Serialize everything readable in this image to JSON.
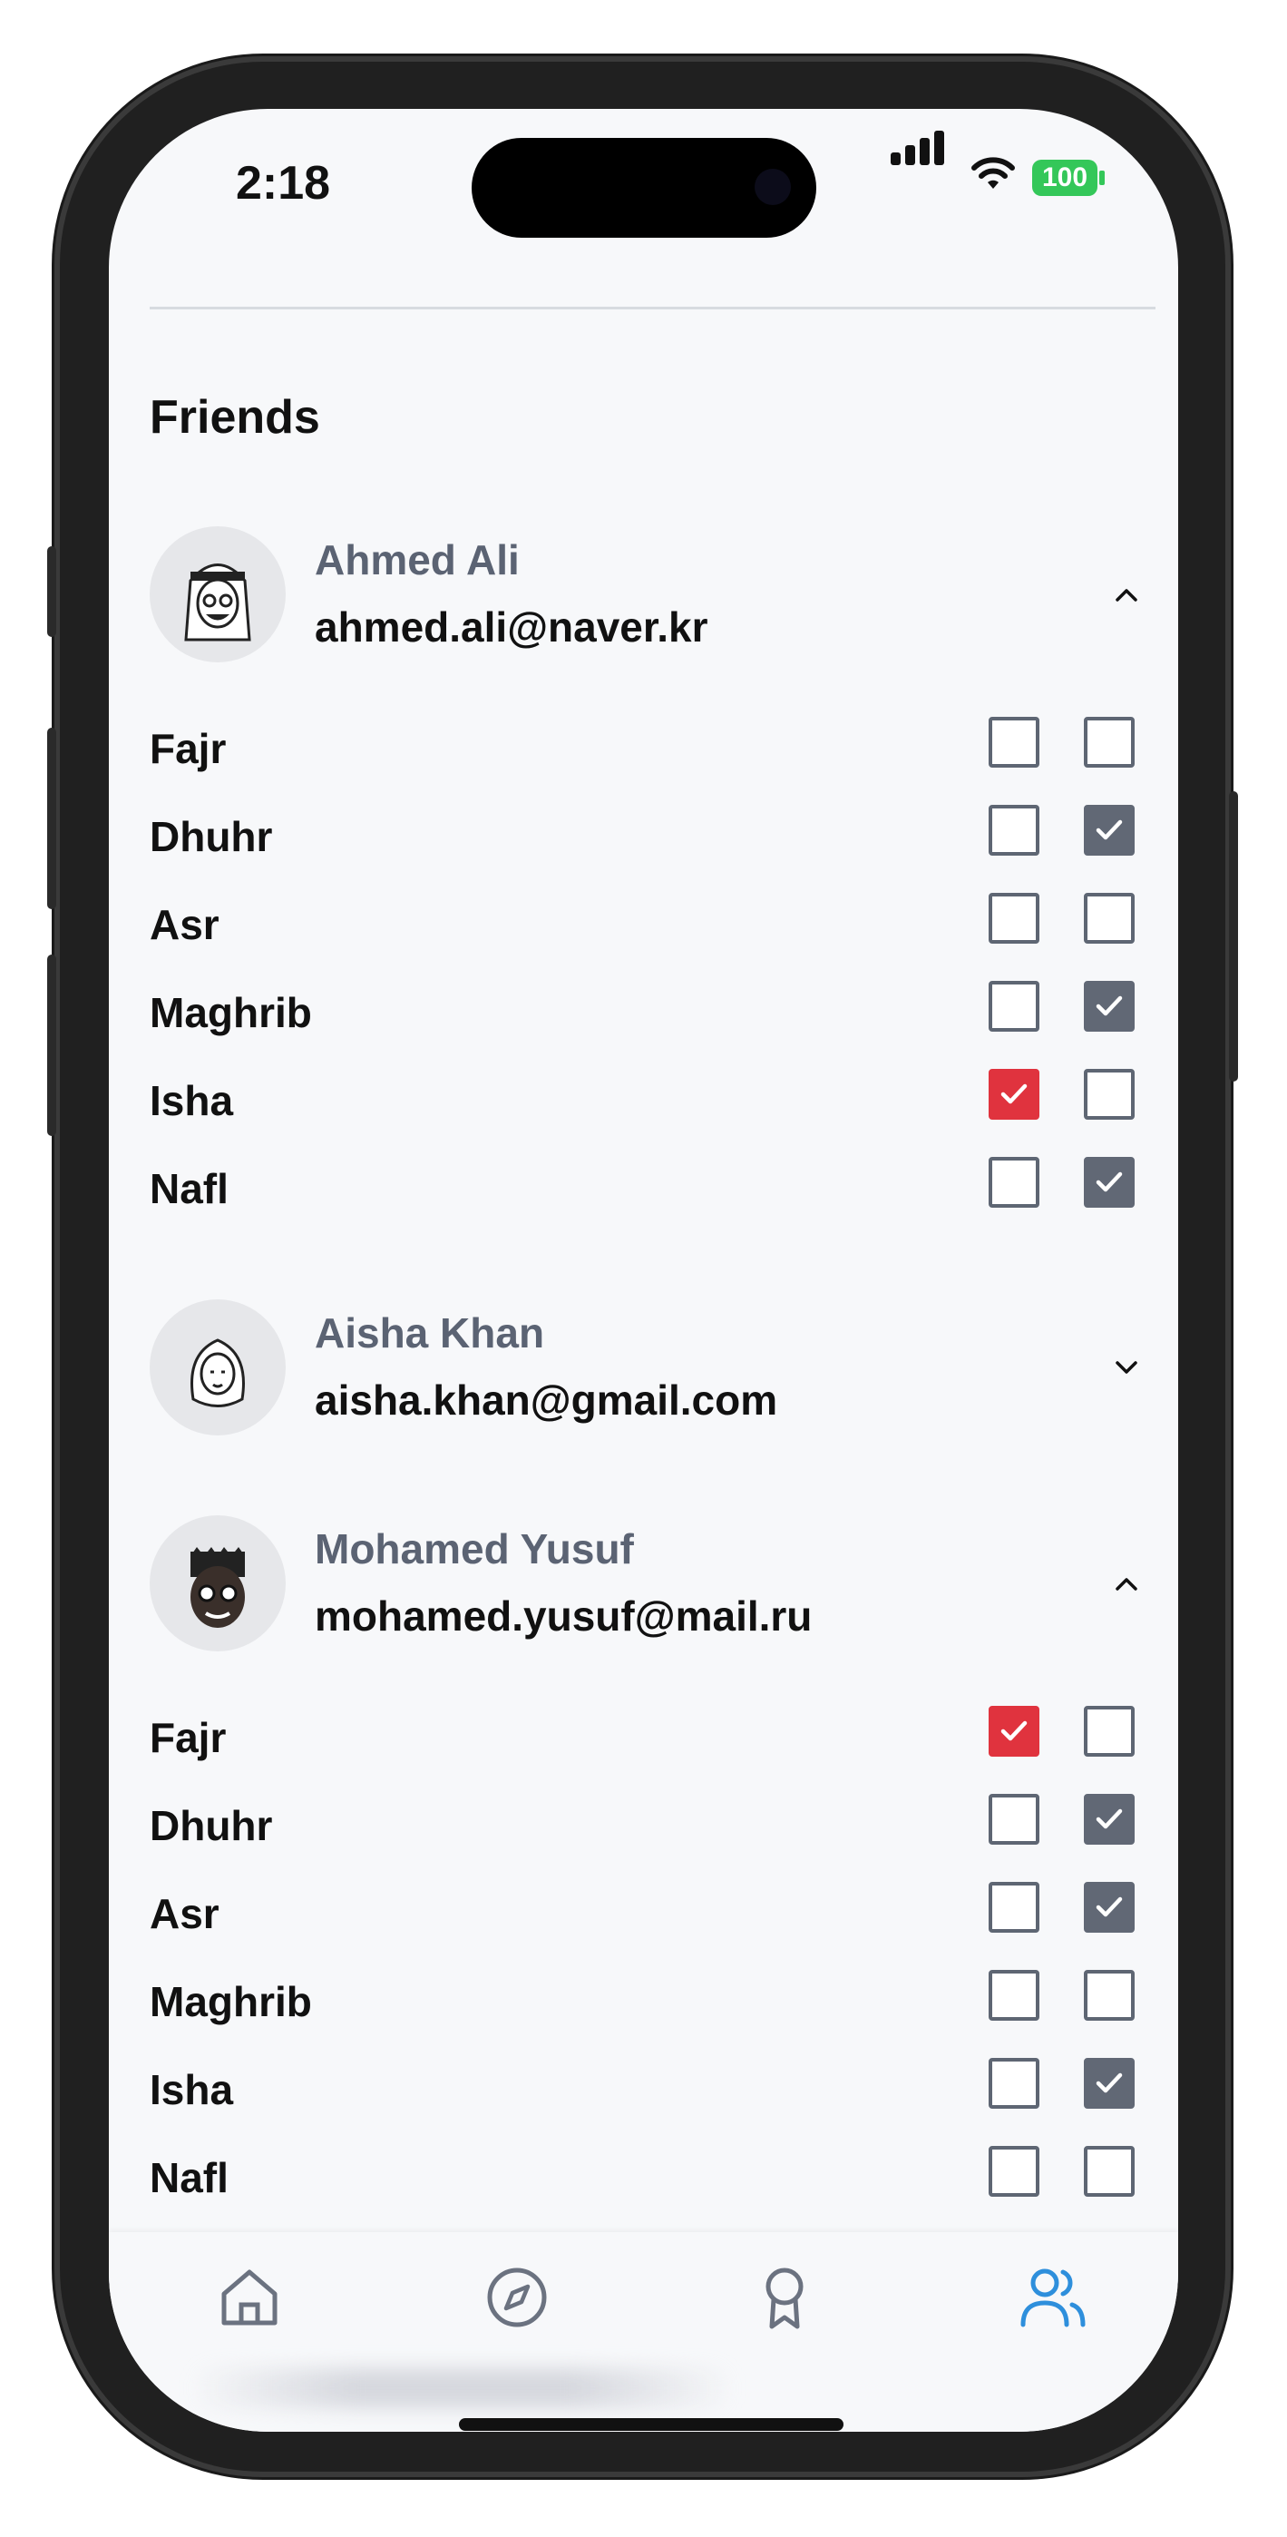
{
  "status": {
    "time": "2:18",
    "battery": "100"
  },
  "section": {
    "title": "Friends"
  },
  "friends": [
    {
      "name": "Ahmed Ali",
      "email": "ahmed.ali@naver.kr",
      "expanded": true,
      "prayers": [
        {
          "label": "Fajr",
          "checks": [
            "none",
            "none",
            "blue"
          ]
        },
        {
          "label": "Dhuhr",
          "checks": [
            "none",
            "gray",
            "none"
          ]
        },
        {
          "label": "Asr",
          "checks": [
            "none",
            "none",
            "blue"
          ]
        },
        {
          "label": "Maghrib",
          "checks": [
            "none",
            "gray",
            "none"
          ]
        },
        {
          "label": "Isha",
          "checks": [
            "red",
            "none",
            "none"
          ]
        },
        {
          "label": "Nafl",
          "checks": [
            "none",
            "gray",
            "none"
          ]
        }
      ]
    },
    {
      "name": "Aisha Khan",
      "email": "aisha.khan@gmail.com",
      "expanded": false,
      "prayers": []
    },
    {
      "name": "Mohamed Yusuf",
      "email": "mohamed.yusuf@mail.ru",
      "expanded": true,
      "prayers": [
        {
          "label": "Fajr",
          "checks": [
            "red",
            "none",
            "none"
          ]
        },
        {
          "label": "Dhuhr",
          "checks": [
            "none",
            "gray",
            "none"
          ]
        },
        {
          "label": "Asr",
          "checks": [
            "none",
            "gray",
            "none"
          ]
        },
        {
          "label": "Maghrib",
          "checks": [
            "none",
            "none",
            "blue"
          ]
        },
        {
          "label": "Isha",
          "checks": [
            "none",
            "gray",
            "none"
          ]
        },
        {
          "label": "Nafl",
          "checks": [
            "none",
            "none",
            "blue"
          ]
        }
      ]
    }
  ],
  "tabs": [
    {
      "icon": "home-icon",
      "active": false
    },
    {
      "icon": "compass-icon",
      "active": false
    },
    {
      "icon": "award-icon",
      "active": false
    },
    {
      "icon": "friends-icon",
      "active": true
    }
  ],
  "colors": {
    "red": "#e0333e",
    "gray": "#616875",
    "blue": "#2e8fdc",
    "active_tab": "#2e8fdc",
    "inactive_tab": "#6b7280"
  }
}
